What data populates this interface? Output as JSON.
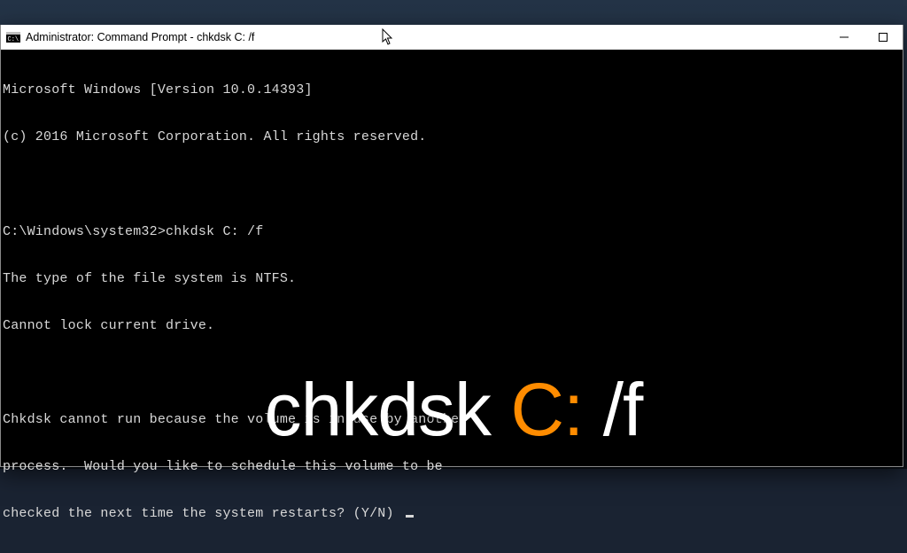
{
  "window": {
    "title": "Administrator: Command Prompt - chkdsk  C: /f"
  },
  "terminal": {
    "line1": "Microsoft Windows [Version 10.0.14393]",
    "line2": "(c) 2016 Microsoft Corporation. All rights reserved.",
    "prompt": "C:\\Windows\\system32>chkdsk C: /f",
    "fs1": "The type of the file system is NTFS.",
    "fs2": "Cannot lock current drive.",
    "msg1": "Chkdsk cannot run because the volume is in use by another",
    "msg2": "process.  Would you like to schedule this volume to be",
    "msg3": "checked the next time the system restarts? (Y/N) "
  },
  "overlay": {
    "seg1": "chkdsk ",
    "seg2": "C:",
    "seg3": " /f"
  }
}
